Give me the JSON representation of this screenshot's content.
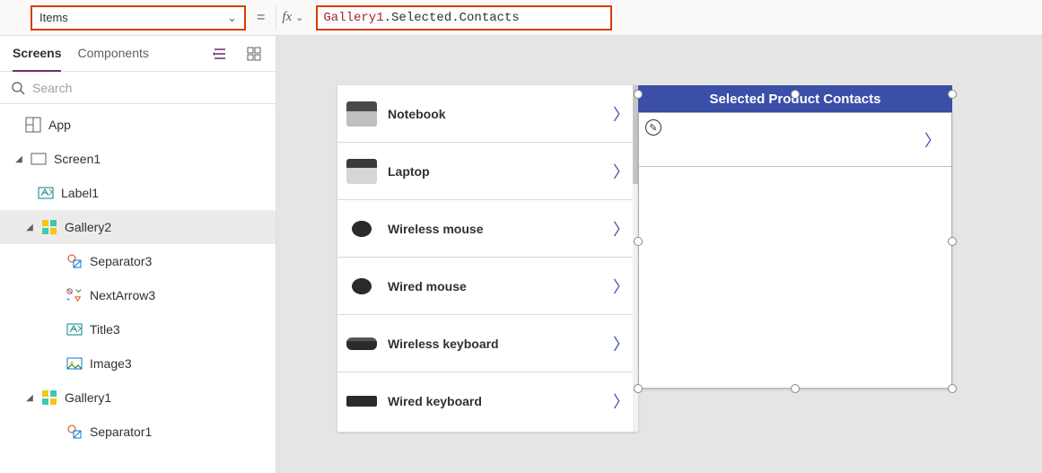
{
  "formulaBar": {
    "property": "Items",
    "equals": "=",
    "fxLabel": "fx",
    "formulaRef": "Gallery1",
    "formulaRest": ".Selected.Contacts"
  },
  "leftPanel": {
    "tabs": {
      "screens": "Screens",
      "components": "Components"
    },
    "searchPlaceholder": "Search",
    "tree": {
      "app": "App",
      "screen1": "Screen1",
      "label1": "Label1",
      "gallery2": "Gallery2",
      "separator3": "Separator3",
      "nextarrow3": "NextArrow3",
      "title3": "Title3",
      "image3": "Image3",
      "gallery1": "Gallery1",
      "separator1": "Separator1"
    }
  },
  "canvas": {
    "labelText": "Selected Product Contacts",
    "products": [
      {
        "name": "Notebook"
      },
      {
        "name": "Laptop"
      },
      {
        "name": "Wireless mouse"
      },
      {
        "name": "Wired mouse"
      },
      {
        "name": "Wireless keyboard"
      },
      {
        "name": "Wired keyboard"
      }
    ]
  }
}
